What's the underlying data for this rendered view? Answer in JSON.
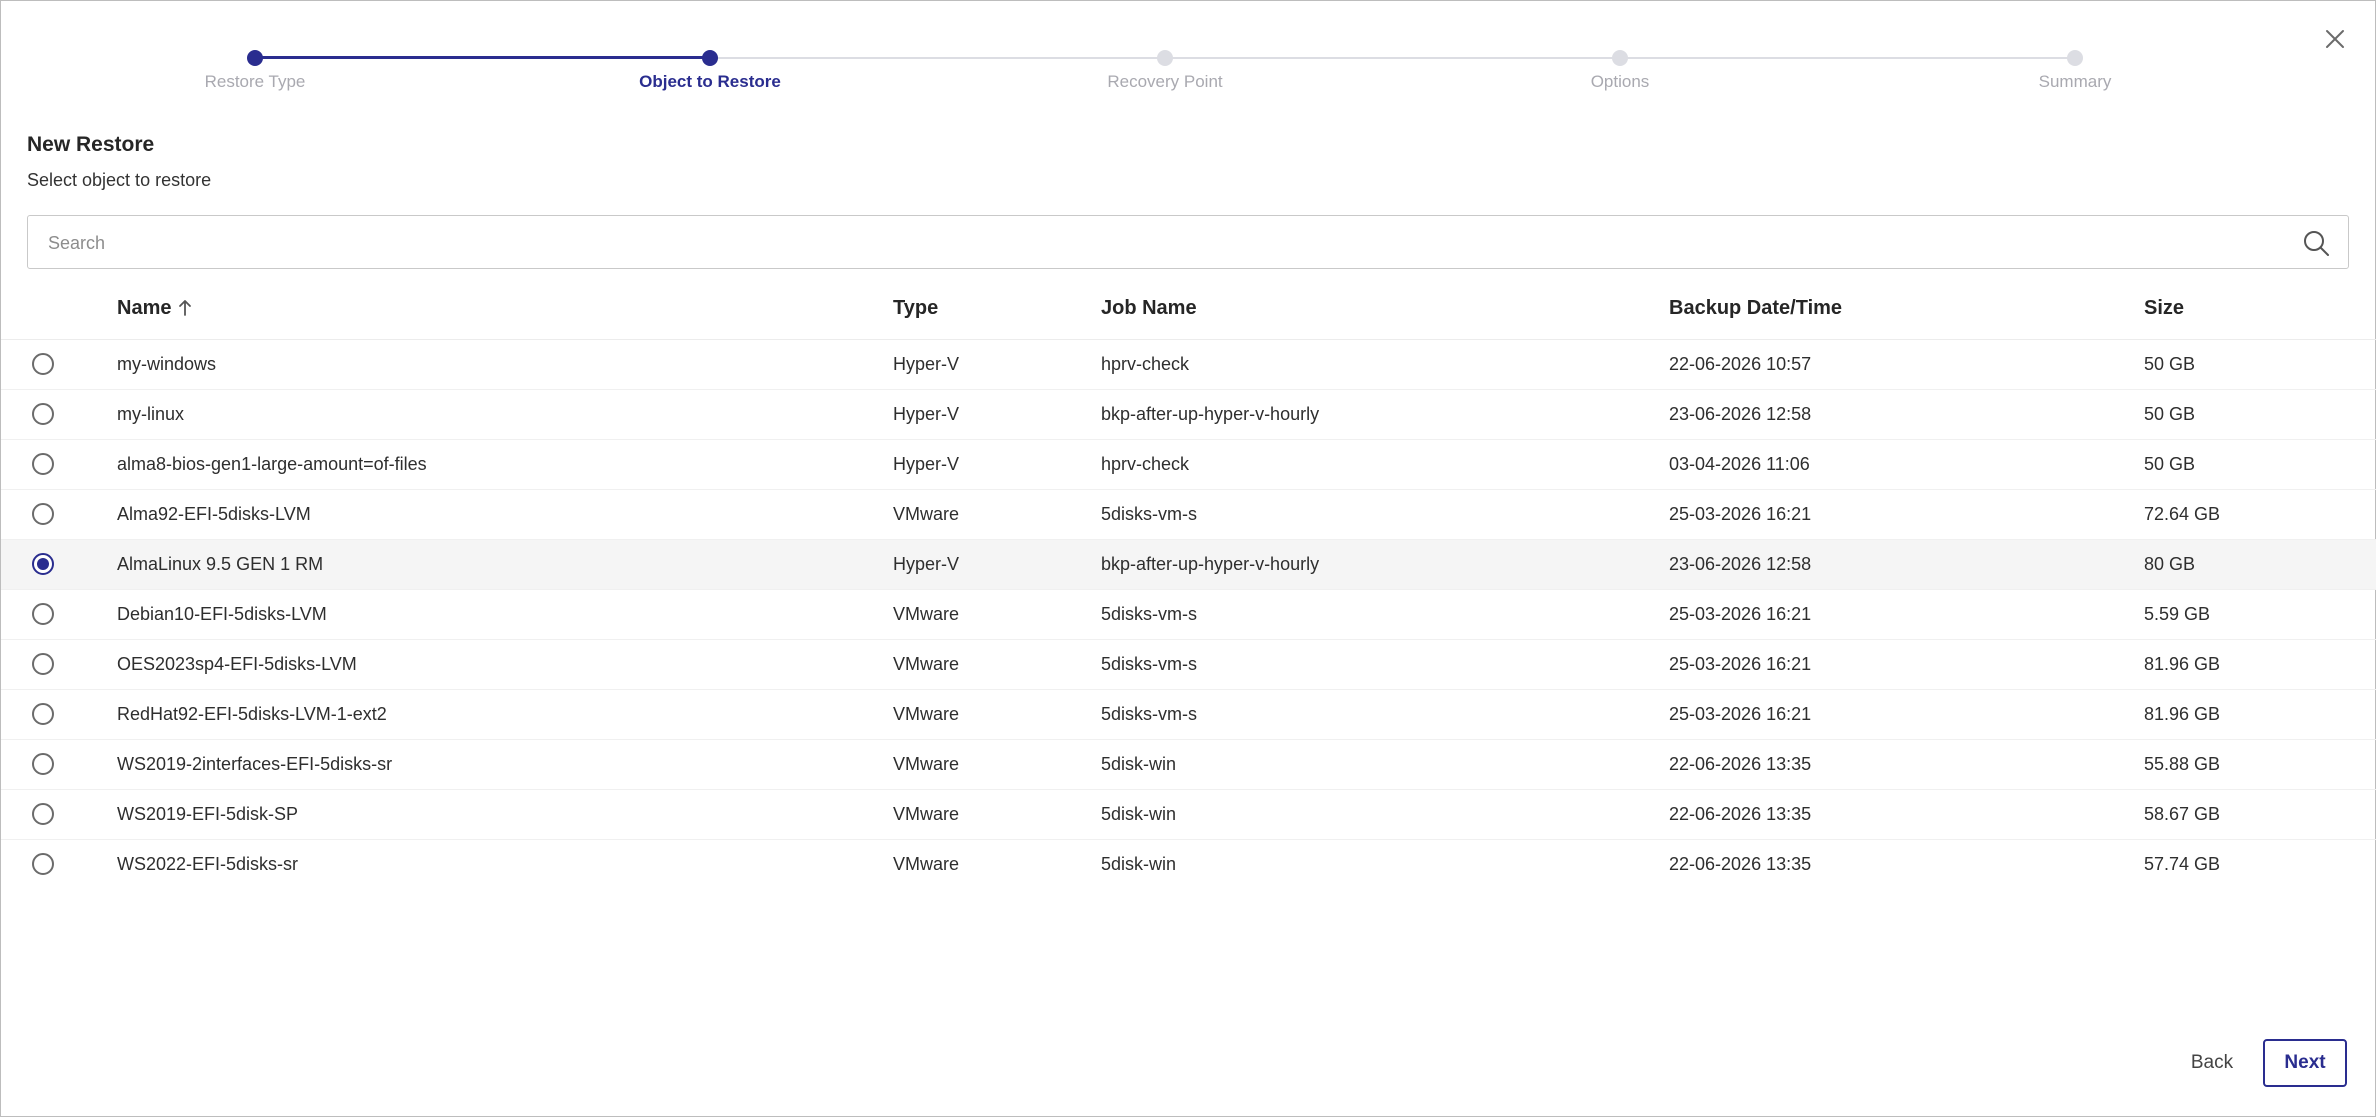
{
  "colors": {
    "accent": "#2a2d8f",
    "inactive": "#dcdde3",
    "selected_row": "#f5f5f5"
  },
  "stepper": {
    "steps": [
      {
        "label": "Restore Type",
        "state": "done"
      },
      {
        "label": "Object to Restore",
        "state": "current"
      },
      {
        "label": "Recovery Point",
        "state": "pending"
      },
      {
        "label": "Options",
        "state": "pending"
      },
      {
        "label": "Summary",
        "state": "pending"
      }
    ]
  },
  "dialog": {
    "title": "New Restore",
    "subtitle": "Select object to restore",
    "close_icon": "close-icon"
  },
  "search": {
    "placeholder": "Search",
    "value": "",
    "icon": "search-icon"
  },
  "table": {
    "headers": {
      "name": "Name",
      "type": "Type",
      "job": "Job Name",
      "date": "Backup Date/Time",
      "size": "Size"
    },
    "sort": {
      "column": "Name",
      "direction": "ascending",
      "icon": "arrow-up-icon"
    },
    "rows": [
      {
        "name": "my-windows",
        "type": "Hyper-V",
        "job": "hprv-check",
        "date": "22-06-2026 10:57",
        "size": "50 GB",
        "selected": false
      },
      {
        "name": "my-linux",
        "type": "Hyper-V",
        "job": "bkp-after-up-hyper-v-hourly",
        "date": "23-06-2026 12:58",
        "size": "50 GB",
        "selected": false
      },
      {
        "name": "alma8-bios-gen1-large-amount=of-files",
        "type": "Hyper-V",
        "job": "hprv-check",
        "date": "03-04-2026 11:06",
        "size": "50 GB",
        "selected": false
      },
      {
        "name": "Alma92-EFI-5disks-LVM",
        "type": "VMware",
        "job": "5disks-vm-s",
        "date": "25-03-2026 16:21",
        "size": "72.64 GB",
        "selected": false
      },
      {
        "name": "AlmaLinux 9.5 GEN 1 RM",
        "type": "Hyper-V",
        "job": "bkp-after-up-hyper-v-hourly",
        "date": "23-06-2026 12:58",
        "size": "80 GB",
        "selected": true
      },
      {
        "name": "Debian10-EFI-5disks-LVM",
        "type": "VMware",
        "job": "5disks-vm-s",
        "date": "25-03-2026 16:21",
        "size": "5.59 GB",
        "selected": false
      },
      {
        "name": "OES2023sp4-EFI-5disks-LVM",
        "type": "VMware",
        "job": "5disks-vm-s",
        "date": "25-03-2026 16:21",
        "size": "81.96 GB",
        "selected": false
      },
      {
        "name": "RedHat92-EFI-5disks-LVM-1-ext2",
        "type": "VMware",
        "job": "5disks-vm-s",
        "date": "25-03-2026 16:21",
        "size": "81.96 GB",
        "selected": false
      },
      {
        "name": "WS2019-2interfaces-EFI-5disks-sr",
        "type": "VMware",
        "job": "5disk-win",
        "date": "22-06-2026 13:35",
        "size": "55.88 GB",
        "selected": false
      },
      {
        "name": "WS2019-EFI-5disk-SP",
        "type": "VMware",
        "job": "5disk-win",
        "date": "22-06-2026 13:35",
        "size": "58.67 GB",
        "selected": false
      },
      {
        "name": "WS2022-EFI-5disks-sr",
        "type": "VMware",
        "job": "5disk-win",
        "date": "22-06-2026 13:35",
        "size": "57.74 GB",
        "selected": false
      }
    ]
  },
  "footer": {
    "back_label": "Back",
    "next_label": "Next"
  }
}
